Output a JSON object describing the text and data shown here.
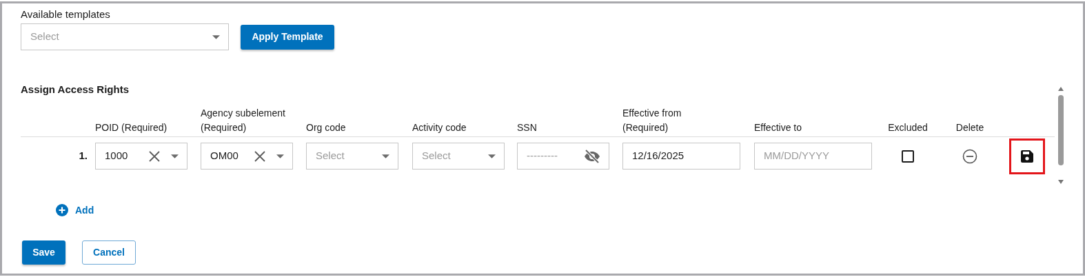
{
  "templates": {
    "label": "Available templates",
    "placeholder": "Select",
    "apply_button": "Apply Template"
  },
  "section_title": "Assign Access Rights",
  "columns": [
    {
      "label": "POID (Required)"
    },
    {
      "label": "Agency subelement (Required)"
    },
    {
      "label": "Org code"
    },
    {
      "label": "Activity code"
    },
    {
      "label": "SSN"
    },
    {
      "label": "Effective from (Required)"
    },
    {
      "label": "Effective to"
    },
    {
      "label": "Excluded"
    },
    {
      "label": "Delete"
    }
  ],
  "rows": [
    {
      "number": "1.",
      "cells": [
        {
          "kind": "select",
          "value": "1000",
          "clearable": true
        },
        {
          "kind": "select",
          "value": "OM00",
          "clearable": true
        },
        {
          "kind": "select",
          "placeholder": "Select"
        },
        {
          "kind": "select",
          "placeholder": "Select"
        },
        {
          "kind": "ssn",
          "placeholder": "---------"
        },
        {
          "kind": "date",
          "value": "12/16/2025"
        },
        {
          "kind": "date",
          "placeholder": "MM/DD/YYYY"
        },
        {
          "kind": "checkbox",
          "checked": false
        },
        {
          "kind": "delete"
        },
        {
          "kind": "save",
          "highlighted": true
        }
      ]
    }
  ],
  "add_button": "Add",
  "buttons": [
    {
      "kind": "primary",
      "label": "Save"
    },
    {
      "kind": "outline",
      "label": "Cancel"
    }
  ]
}
